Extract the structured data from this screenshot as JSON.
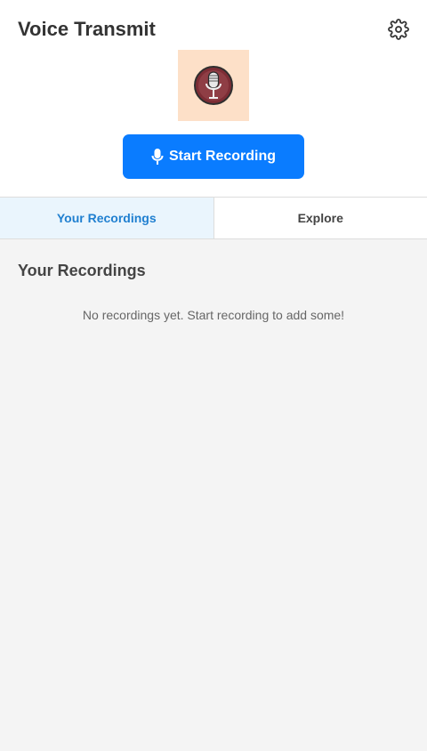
{
  "app": {
    "title": "Voice Transmit"
  },
  "header": {
    "settings_icon": "gear-icon",
    "logo_icon": "microphone-logo",
    "record_button": {
      "label": "Start Recording",
      "icon": "microphone-icon"
    }
  },
  "tabs": [
    {
      "label": "Your Recordings",
      "active": true
    },
    {
      "label": "Explore",
      "active": false
    }
  ],
  "recordings": {
    "title": "Your Recordings",
    "empty_message": "No recordings yet. Start recording to add some!",
    "items": []
  },
  "colors": {
    "primary": "#0a7cff",
    "active_tab_bg": "#eaf5fd",
    "active_tab_text": "#1f7fd0",
    "logo_bg": "#fde0c8",
    "page_bg": "#f4f4f4"
  }
}
